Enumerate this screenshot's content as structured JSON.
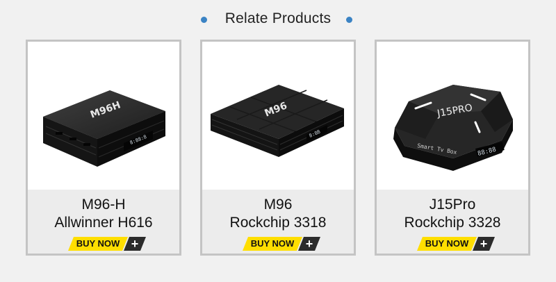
{
  "header": {
    "title": "Relate Products"
  },
  "colors": {
    "accent_dot": "#3b83c4",
    "buy_yellow": "#ffde00",
    "plus_dark": "#2b2b2b",
    "card_border": "#c4c4c4"
  },
  "products": [
    {
      "name": "M96-H",
      "chip": "Allwinner H616",
      "buy_label": "BUY NOW",
      "plus": "+",
      "box_logo": "M96H",
      "display": "8:88:8"
    },
    {
      "name": "M96",
      "chip": "Rockchip 3318",
      "buy_label": "BUY NOW",
      "plus": "+",
      "box_logo": "M96",
      "display": "8:8B"
    },
    {
      "name": "J15Pro",
      "chip": "Rockchip 3328",
      "buy_label": "BUY NOW",
      "plus": "+",
      "box_logo": "J15PRO",
      "box_text": "Smart Tv Box",
      "display": "88:88"
    }
  ]
}
